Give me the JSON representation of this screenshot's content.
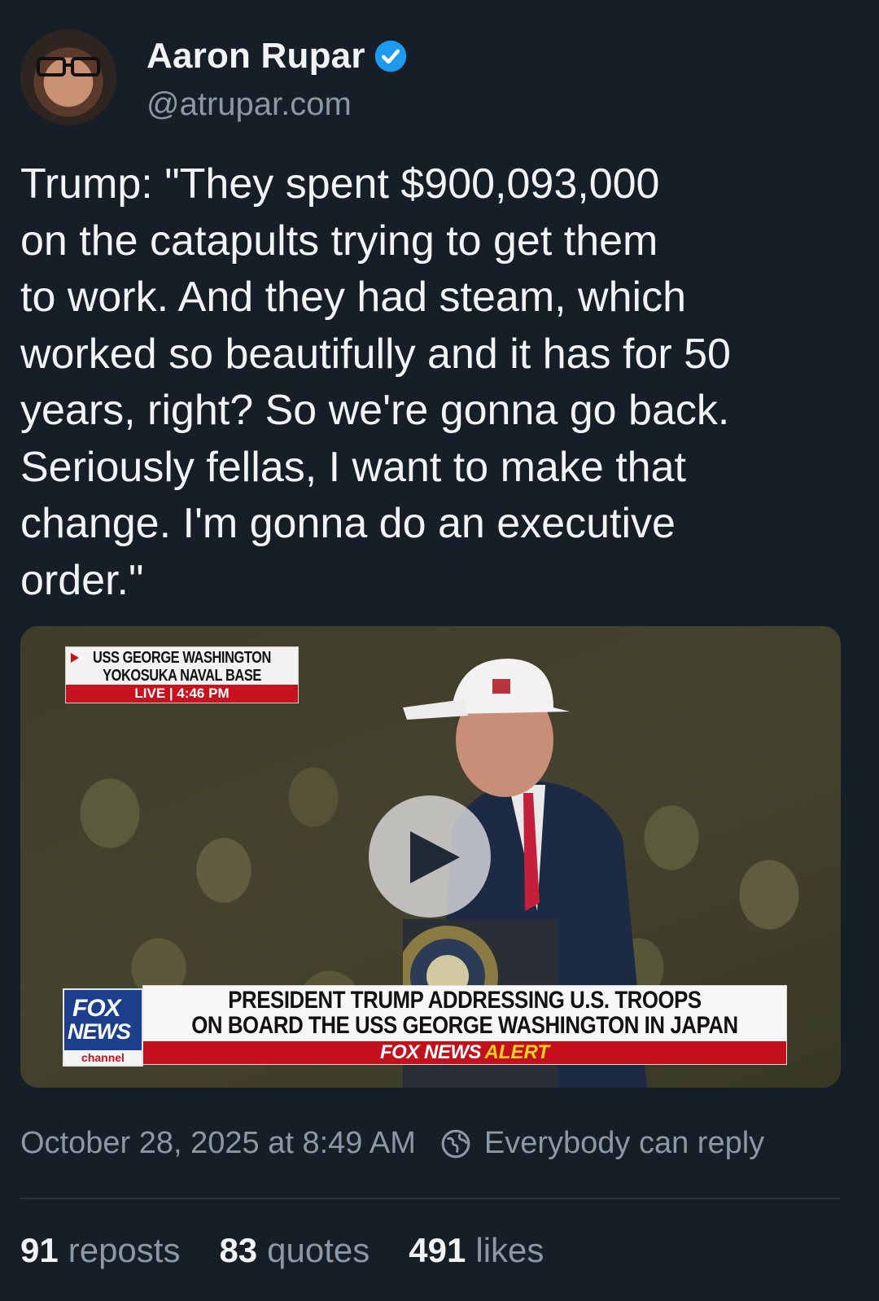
{
  "author": {
    "display_name": "Aaron Rupar",
    "handle": "@atrupar.com",
    "verified": true
  },
  "post": {
    "text": "Trump: \"They spent $900,093,000\non the catapults trying to get them\nto work. And they had steam, which\nworked so beautifully and it has for 50\nyears, right? So we're gonna go back.\nSeriously fellas, I want to make that\nchange. I'm gonna do an executive\norder.\""
  },
  "video": {
    "location_line1": "USS GEORGE WASHINGTON",
    "location_line2": "YOKOSUKA NAVAL BASE",
    "live_label": "LIVE  |  4:46 PM",
    "logo_fox": "FOX",
    "logo_news": "NEWS",
    "logo_channel": "channel",
    "headline_line1": "PRESIDENT TRUMP ADDRESSING U.S. TROOPS",
    "headline_line2": "ON BOARD THE USS GEORGE WASHINGTON IN JAPAN",
    "alert_brand": "FOX NEWS",
    "alert_word": "ALERT",
    "play_icon": "play-icon"
  },
  "meta": {
    "timestamp": "October 28, 2025 at 8:49 AM",
    "reply_setting": "Everybody can reply",
    "reply_icon": "globe-icon"
  },
  "stats": {
    "reposts_count": "91",
    "reposts_label": "reposts",
    "quotes_count": "83",
    "quotes_label": "quotes",
    "likes_count": "491",
    "likes_label": "likes"
  },
  "colors": {
    "background": "#161e27",
    "text_primary": "#f1f3f5",
    "text_secondary": "#8b98a5",
    "verified_blue": "#1d9bf0"
  }
}
